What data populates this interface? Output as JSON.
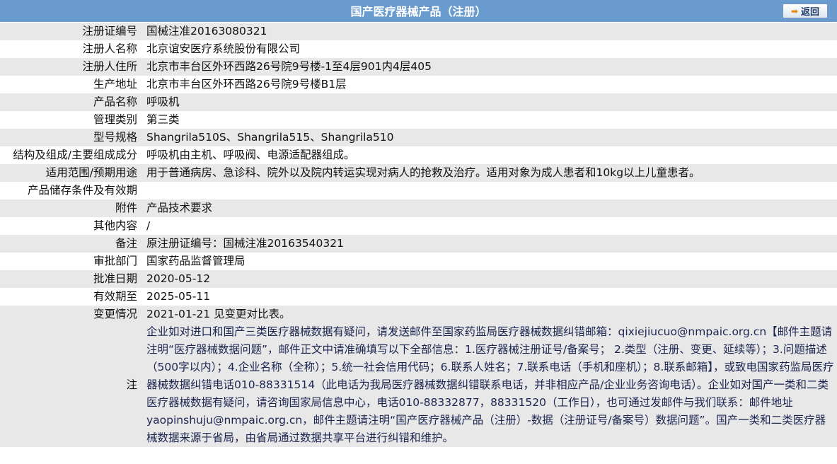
{
  "header": {
    "title": "国产医疗器械产品（注册）",
    "back_label": "返回"
  },
  "rows": [
    {
      "label": "注册证编号",
      "value": "国械注准20163080321"
    },
    {
      "label": "注册人名称",
      "value": "北京谊安医疗系统股份有限公司"
    },
    {
      "label": "注册人住所",
      "value": "北京市丰台区外环西路26号院9号楼-1至4层901内4层405"
    },
    {
      "label": "生产地址",
      "value": "北京市丰台区外环西路26号院9号楼B1层"
    },
    {
      "label": "产品名称",
      "value": "呼吸机"
    },
    {
      "label": "管理类别",
      "value": "第三类"
    },
    {
      "label": "型号规格",
      "value": "Shangrila510S、Shangrila515、Shangrila510"
    },
    {
      "label": "结构及组成/主要组成成分",
      "value": "呼吸机由主机、呼吸阀、电源适配器组成。"
    },
    {
      "label": "适用范围/预期用途",
      "value": "用于普通病房、急诊科、院外以及院内转运实现对病人的抢救及治疗。适用对象为成人患者和10kg以上儿童患者。"
    },
    {
      "label": "产品储存条件及有效期",
      "value": ""
    },
    {
      "label": "附件",
      "value": "产品技术要求"
    },
    {
      "label": "其他内容",
      "value": "/"
    },
    {
      "label": "备注",
      "value": "原注册证编号：国械注准20163540321"
    },
    {
      "label": "审批部门",
      "value": "国家药品监督管理局"
    },
    {
      "label": "批准日期",
      "value": "2020-05-12"
    },
    {
      "label": "有效期至",
      "value": "2025-05-11"
    },
    {
      "label": "变更情况",
      "value": "2021-01-21 见变更对比表。"
    }
  ],
  "note": {
    "label": "注",
    "text": "企业如对进口和国产三类医疗器械数据有疑问，请发送邮件至国家药监局医疗器械数据纠错邮箱：qixiejiucuo@nmpaic.org.cn【邮件主题请注明“医疗器械数据问题”，邮件正文中请准确填写以下全部信息：1.医疗器械注册证号/备案号； 2.类型（注册、变更、延续等）；3.问题描述（500字以内）；4.企业名称（全称）；5.统一社会信用代码；6.联系人姓名；7.联系电话（手机和座机）；8.联系邮箱】，或致电国家药监局医疗器械数据纠错电话010-88331514（此电话为我局医疗器械数据纠错联系电话，并非相应产品/企业业务咨询电话）。企业如对国产一类和二类医疗器械数据有疑问，请咨询国家局信息中心，电话010-88332877，88331520（工作日），也可通过发邮件与我们联系：邮件地址 yaopinshuju@nmpaic.org.cn，邮件主题请注明“国产医疗器械产品（注册）-数据（注册证号/备案号）数据问题”。国产一类和二类医疗器械数据来源于省局，由省局通过数据共享平台进行纠错和维护。"
  }
}
